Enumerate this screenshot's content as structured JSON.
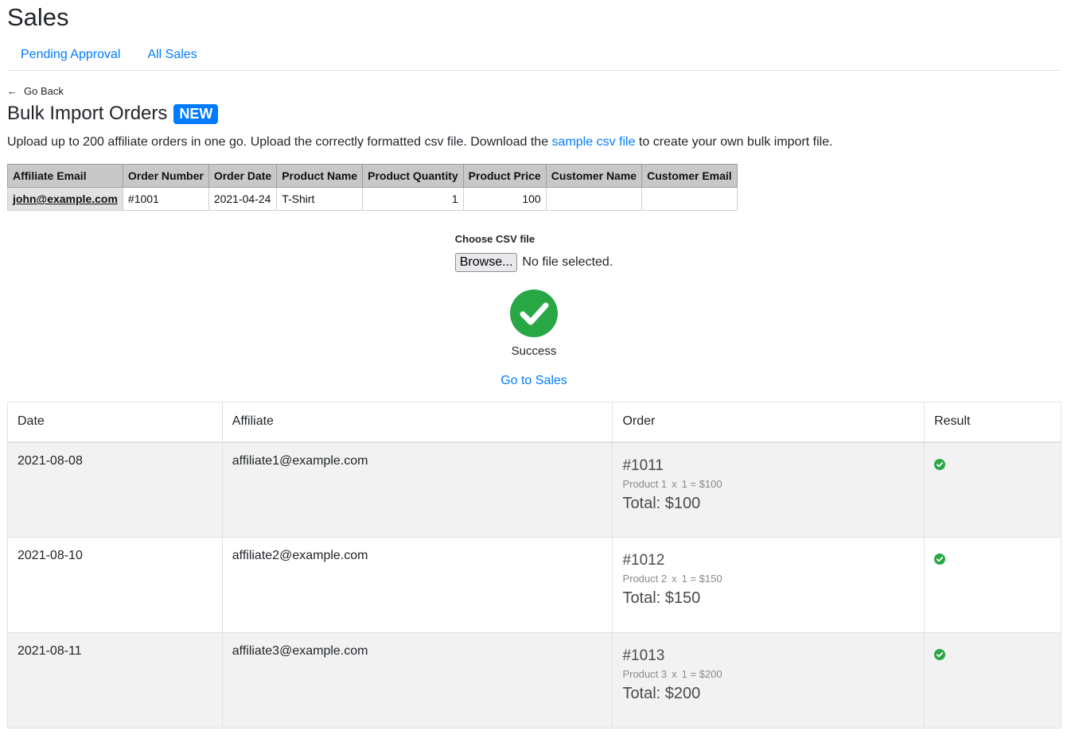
{
  "header": {
    "title": "Sales"
  },
  "tabs": [
    {
      "label": "Pending Approval"
    },
    {
      "label": "All Sales"
    }
  ],
  "back": {
    "label": "Go Back"
  },
  "bulk": {
    "title": "Bulk Import Orders",
    "badge": "NEW",
    "intro_before": "Upload up to 200 affiliate orders in one go. Upload the correctly formatted csv file. Download the ",
    "intro_link": "sample csv file",
    "intro_after": " to create your own bulk import file."
  },
  "sample_table": {
    "headers": [
      "Affiliate Email",
      "Order Number",
      "Order Date",
      "Product Name",
      "Product Quantity",
      "Product Price",
      "Customer Name",
      "Customer Email"
    ],
    "row": [
      "john@example.com",
      "#1001",
      "2021-04-24",
      "T-Shirt",
      "1",
      "100",
      "",
      ""
    ]
  },
  "upload": {
    "label": "Choose CSV file",
    "browse_label": "Browse...",
    "file_status": "No file selected."
  },
  "status": {
    "text": "Success",
    "go_to_sales": "Go to Sales",
    "color": "#28a745"
  },
  "results": {
    "headers": [
      "Date",
      "Affiliate",
      "Order",
      "Result"
    ],
    "rows": [
      {
        "date": "2021-08-08",
        "affiliate": "affiliate1@example.com",
        "order": "#1011",
        "product": "Product 1",
        "qty_sep": "x",
        "qty": "1",
        "eq": "= $100",
        "total": "Total: $100",
        "result_icon": "check-circle-icon"
      },
      {
        "date": "2021-08-10",
        "affiliate": "affiliate2@example.com",
        "order": "#1012",
        "product": "Product 2",
        "qty_sep": "x",
        "qty": "1",
        "eq": "= $150",
        "total": "Total: $150",
        "result_icon": "check-circle-icon"
      },
      {
        "date": "2021-08-11",
        "affiliate": "affiliate3@example.com",
        "order": "#1013",
        "product": "Product 3",
        "qty_sep": "x",
        "qty": "1",
        "eq": "= $200",
        "total": "Total: $200",
        "result_icon": "check-circle-icon"
      }
    ]
  }
}
